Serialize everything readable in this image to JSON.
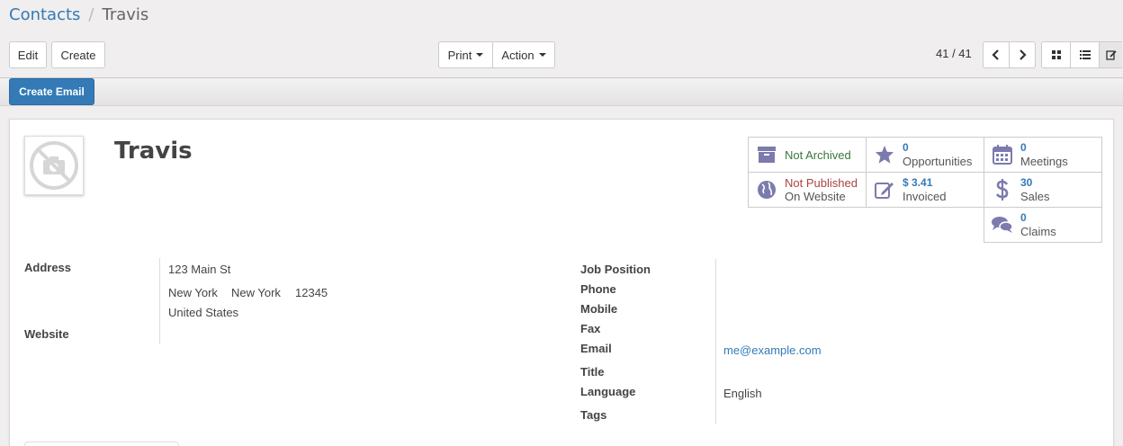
{
  "breadcrumb": {
    "parent": "Contacts",
    "separator": "/",
    "current": "Travis"
  },
  "toolbar": {
    "edit_label": "Edit",
    "create_label": "Create",
    "print_label": "Print",
    "action_label": "Action",
    "pager": "41 / 41",
    "create_email_label": "Create Email"
  },
  "record": {
    "name": "Travis",
    "stats": {
      "archived": {
        "label": "Not Archived",
        "color": "#3c763d"
      },
      "opportunities": {
        "count": "0",
        "label": "Opportunities"
      },
      "meetings": {
        "count": "0",
        "label": "Meetings"
      },
      "published": {
        "label": "Not Published",
        "sublabel": "On Website",
        "color": "#a94442"
      },
      "invoiced": {
        "count": "$ 3.41",
        "label": "Invoiced"
      },
      "sales": {
        "count": "30",
        "label": "Sales"
      },
      "claims": {
        "count": "0",
        "label": "Claims"
      }
    },
    "labels": {
      "address": "Address",
      "website": "Website",
      "job_position": "Job Position",
      "phone": "Phone",
      "mobile": "Mobile",
      "fax": "Fax",
      "email": "Email",
      "title": "Title",
      "language": "Language",
      "tags": "Tags"
    },
    "address": {
      "street": "123 Main St",
      "city": "New York",
      "state": "New York",
      "zip": "12345",
      "country": "United States"
    },
    "email": "me@example.com",
    "language": "English"
  },
  "colors": {
    "accent": "#337ab7",
    "icon": "#7c7bad"
  }
}
